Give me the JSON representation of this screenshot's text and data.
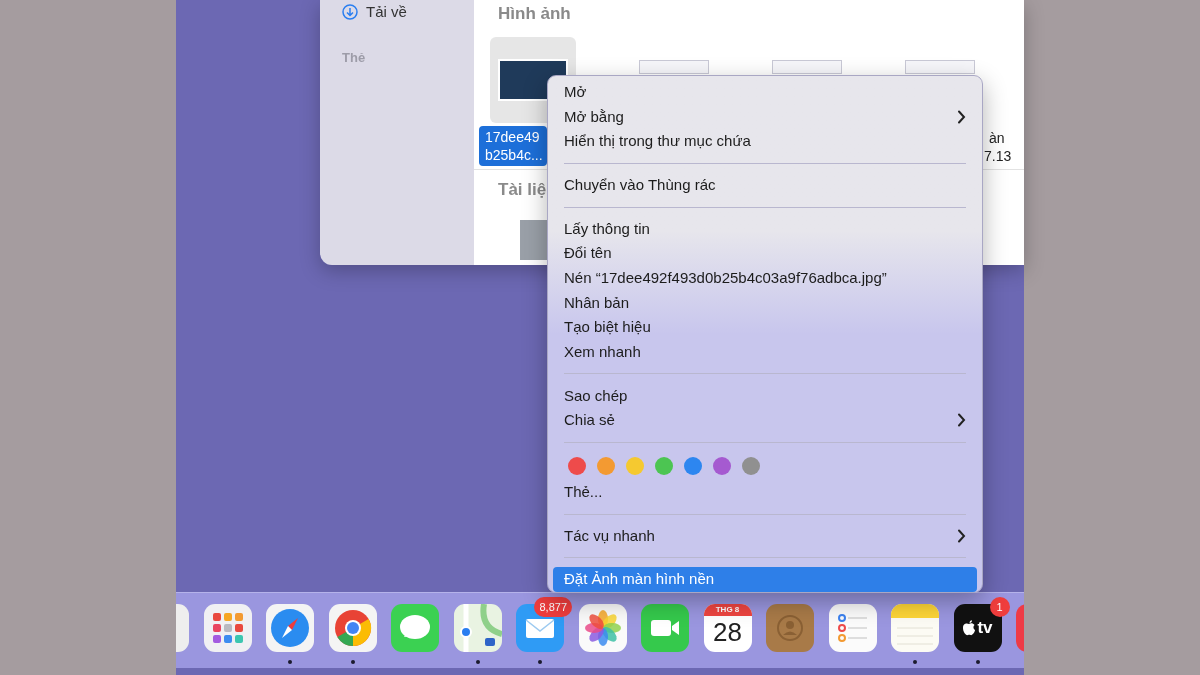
{
  "sidebar": {
    "items": [
      {
        "label": "Tải về",
        "selected": false
      }
    ],
    "section_heading": "Thẻ"
  },
  "content": {
    "section_1": "Hình ảnh",
    "selected_file": {
      "line_1": "17dee49",
      "line_2": "b25b4c...",
      "selected": true
    },
    "partial_label": {
      "line_1": "àn",
      "line_2": "7.13"
    },
    "section_2": "Tài liệ"
  },
  "context_menu": {
    "items": [
      {
        "kind": "item",
        "label": "Mở",
        "submenu": false,
        "selected": false
      },
      {
        "kind": "item",
        "label": "Mở bằng",
        "submenu": true,
        "selected": false
      },
      {
        "kind": "item",
        "label": "Hiển thị trong thư mục chứa",
        "submenu": false,
        "selected": false
      },
      {
        "kind": "separator"
      },
      {
        "kind": "item",
        "label": "Chuyển vào Thùng rác",
        "submenu": false,
        "selected": false
      },
      {
        "kind": "separator"
      },
      {
        "kind": "item",
        "label": "Lấy thông tin",
        "submenu": false,
        "selected": false
      },
      {
        "kind": "item",
        "label": "Đổi tên",
        "submenu": false,
        "selected": false
      },
      {
        "kind": "item",
        "label": "Nén “17dee492f493d0b25b4c03a9f76adbca.jpg”",
        "submenu": false,
        "selected": false
      },
      {
        "kind": "item",
        "label": "Nhân bản",
        "submenu": false,
        "selected": false
      },
      {
        "kind": "item",
        "label": "Tạo biệt hiệu",
        "submenu": false,
        "selected": false
      },
      {
        "kind": "item",
        "label": "Xem nhanh",
        "submenu": false,
        "selected": false
      },
      {
        "kind": "separator"
      },
      {
        "kind": "item",
        "label": "Sao chép",
        "submenu": false,
        "selected": false
      },
      {
        "kind": "item",
        "label": "Chia sẻ",
        "submenu": true,
        "selected": false
      },
      {
        "kind": "separator"
      },
      {
        "kind": "colors",
        "colors": [
          {
            "color": "#ee4b4b"
          },
          {
            "color": "#f39a32"
          },
          {
            "color": "#f5c930"
          },
          {
            "color": "#4cc552"
          },
          {
            "color": "#2d86f0"
          },
          {
            "color": "#a55ad0"
          },
          {
            "color": "#909090"
          }
        ]
      },
      {
        "kind": "item",
        "label": "Thẻ...",
        "submenu": false,
        "selected": false
      },
      {
        "kind": "separator"
      },
      {
        "kind": "item",
        "label": "Tác vụ nhanh",
        "submenu": true,
        "selected": false
      },
      {
        "kind": "separator"
      },
      {
        "kind": "item",
        "label": "Đặt Ảnh màn hình nền",
        "submenu": false,
        "selected": true
      }
    ]
  },
  "dock": {
    "apps": [
      {
        "kind": "generic",
        "running": false
      },
      {
        "kind": "grid",
        "running": false
      },
      {
        "kind": "compass",
        "running": true
      },
      {
        "kind": "chrome",
        "running": true
      },
      {
        "kind": "bubble",
        "running": false
      },
      {
        "kind": "map",
        "running": true
      },
      {
        "kind": "mail",
        "running": true,
        "badge": "8,877"
      },
      {
        "kind": "flower",
        "running": false
      },
      {
        "kind": "video",
        "running": false
      },
      {
        "kind": "calendar",
        "running": false,
        "month": "THG 8",
        "day": "28"
      },
      {
        "kind": "contacts",
        "running": false
      },
      {
        "kind": "checklist",
        "running": false
      },
      {
        "kind": "notes",
        "running": true
      },
      {
        "kind": "tv",
        "running": true,
        "badge": "1",
        "text": "tv"
      },
      {
        "kind": "red",
        "running": false
      }
    ]
  }
}
